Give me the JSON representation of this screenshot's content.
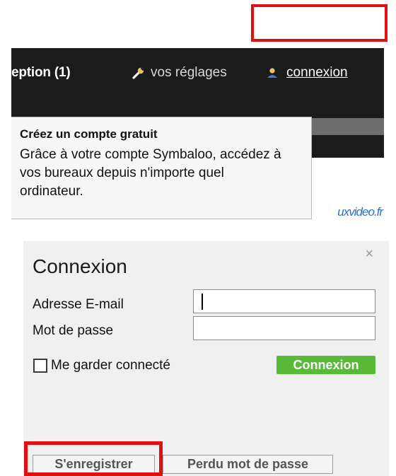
{
  "header": {
    "reception_tab": "eption (1)",
    "settings_link": "vos réglages",
    "login_link": "connexion"
  },
  "tooltip": {
    "title": "Créez un compte gratuit",
    "body": "Grâce à votre compte Symbaloo, accédez à vos bureaux depuis n'importe quel ordinateur."
  },
  "tile": {
    "site_label": "uxvideo.fr"
  },
  "dialog": {
    "title": "Connexion",
    "close_symbol": "×",
    "email_label": "Adresse E-mail",
    "email_value": "",
    "password_label": "Mot de passe",
    "password_value": "",
    "remember_label": "Me garder connecté",
    "remember_checked": false,
    "login_button": "Connexion",
    "register_button": "S'enregistrer",
    "forgot_button": "Perdu mot de passe"
  },
  "colors": {
    "highlight": "#e01010",
    "topbar_bg": "#1b1b1b",
    "login_button_bg": "#59b938",
    "dialog_bg": "#f0f0f0",
    "link_blue": "#2e6fd1"
  },
  "icons": {
    "settings": "wrench-icon",
    "login": "user-icon",
    "close": "close-icon"
  }
}
